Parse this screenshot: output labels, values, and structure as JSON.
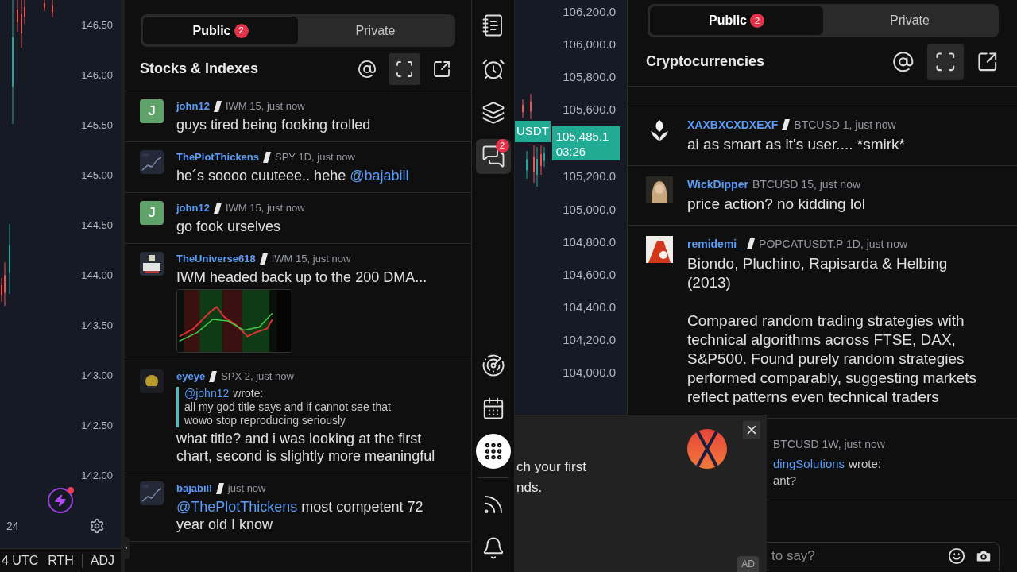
{
  "left_chart": {
    "price_axis": [
      "146.50",
      "146.00",
      "145.50",
      "145.00",
      "144.50",
      "144.00",
      "143.50",
      "143.00",
      "142.50",
      "142.00"
    ],
    "time_label": "24",
    "bottom_bar": [
      "4 UTC",
      "RTH",
      "ADJ"
    ]
  },
  "left_chat": {
    "tabs": [
      {
        "label": "Public",
        "badge": "2",
        "selected": true
      },
      {
        "label": "Private",
        "selected": false
      }
    ],
    "room": "Stocks & Indexes",
    "header_buttons": [
      {
        "kind": "mention",
        "selected": false
      },
      {
        "kind": "fullscreen",
        "selected": true
      },
      {
        "kind": "popout",
        "selected": false
      }
    ],
    "messages": [
      {
        "user": "john12",
        "pro": true,
        "meta": "IWM 15, just now",
        "avatar": {
          "kind": "letter",
          "letter": "J"
        },
        "text": "guys tired being fooking trolled"
      },
      {
        "user": "ThePlotThickens",
        "pro": true,
        "meta": "SPY 1D, just now",
        "text": "he´s soooo cuuteee.. hehe",
        "mention_after": "@bajabill"
      },
      {
        "user": "john12",
        "pro": true,
        "meta": "IWM 15, just now",
        "avatar": {
          "kind": "letter",
          "letter": "J"
        },
        "text": "go fook urselves"
      },
      {
        "user": "TheUniverse618",
        "pro": true,
        "meta": "IWM 15, just now",
        "text": "IWM headed back up to the 200 DMA...",
        "image": true
      },
      {
        "user": "eyeye",
        "pro": true,
        "meta": "SPX 2, just now",
        "quote": {
          "mention": "@john12",
          "label": "wrote:",
          "text": "all my god title says and if cannot see that wowo stop reproducing seriously"
        },
        "text": "what title? and i was looking at the first chart, second is slightly more meaningful"
      },
      {
        "user": "bajabill",
        "pro": true,
        "meta": "just now",
        "mention_before": "@ThePlotThickens",
        "text": "most competent 72 year old I know"
      }
    ]
  },
  "toolbar": {
    "top": [
      {
        "kind": "notes",
        "selected": false
      },
      {
        "kind": "alarm",
        "selected": false
      },
      {
        "kind": "layers",
        "selected": false
      },
      {
        "kind": "chat",
        "selected": true,
        "badge": "2"
      }
    ],
    "bottom": [
      {
        "kind": "radar",
        "selected": false
      },
      {
        "kind": "calendar",
        "selected": false
      },
      {
        "kind": "apps",
        "selected": false
      }
    ],
    "footer": [
      {
        "kind": "feed",
        "selected": false
      },
      {
        "kind": "bell",
        "selected": false
      }
    ]
  },
  "right_chart": {
    "axis_above_price": [
      "106,200.0",
      "106,000.0",
      "105,800.0",
      "105,600.0"
    ],
    "symbol_tag": "USDT",
    "price": "105,485.1",
    "countdown": "03:26",
    "axis_below_price": [
      "105,200.0",
      "105,000.0",
      "104,800.0",
      "104,600.0",
      "104,400.0",
      "104,200.0",
      "104,000.0"
    ]
  },
  "right_chat": {
    "tabs": [
      {
        "label": "Public",
        "badge": "2",
        "selected": true
      },
      {
        "label": "Private",
        "selected": false
      }
    ],
    "room": "Cryptocurrencies",
    "header_buttons": [
      {
        "kind": "mention",
        "selected": false
      },
      {
        "kind": "fullscreen",
        "selected": true
      },
      {
        "kind": "popout",
        "selected": false
      }
    ],
    "messages": [
      {
        "user": "XAXBXCXDXEXF",
        "pro": true,
        "meta": "BTCUSD 1, just now",
        "text": "ai as smart as it's user.... *smirk*"
      },
      {
        "user": "WickDipper",
        "pro": false,
        "meta": "BTCUSD 15, just now",
        "text": "price action? no kidding lol"
      },
      {
        "user": "remidemi_",
        "pro": true,
        "meta": "POPCATUSDT.P 1D, just now",
        "text": "Biondo, Pluchino, Rapisarda & Helbing (2013)\n\nCompared random trading strategies with technical algorithms across FTSE, DAX, S&P500. Found purely random strategies performed comparably, suggesting markets reflect patterns even technical traders"
      },
      {
        "partial": true,
        "meta": "BTCUSD 1W, just now",
        "quote": {
          "mention": "dingSolutions",
          "label": "wrote:",
          "text": "ant?"
        }
      }
    ],
    "input": {
      "placeholder": "to say?"
    }
  },
  "ad": {
    "lines": [
      "ch your first",
      "nds."
    ],
    "badge": "AD"
  }
}
